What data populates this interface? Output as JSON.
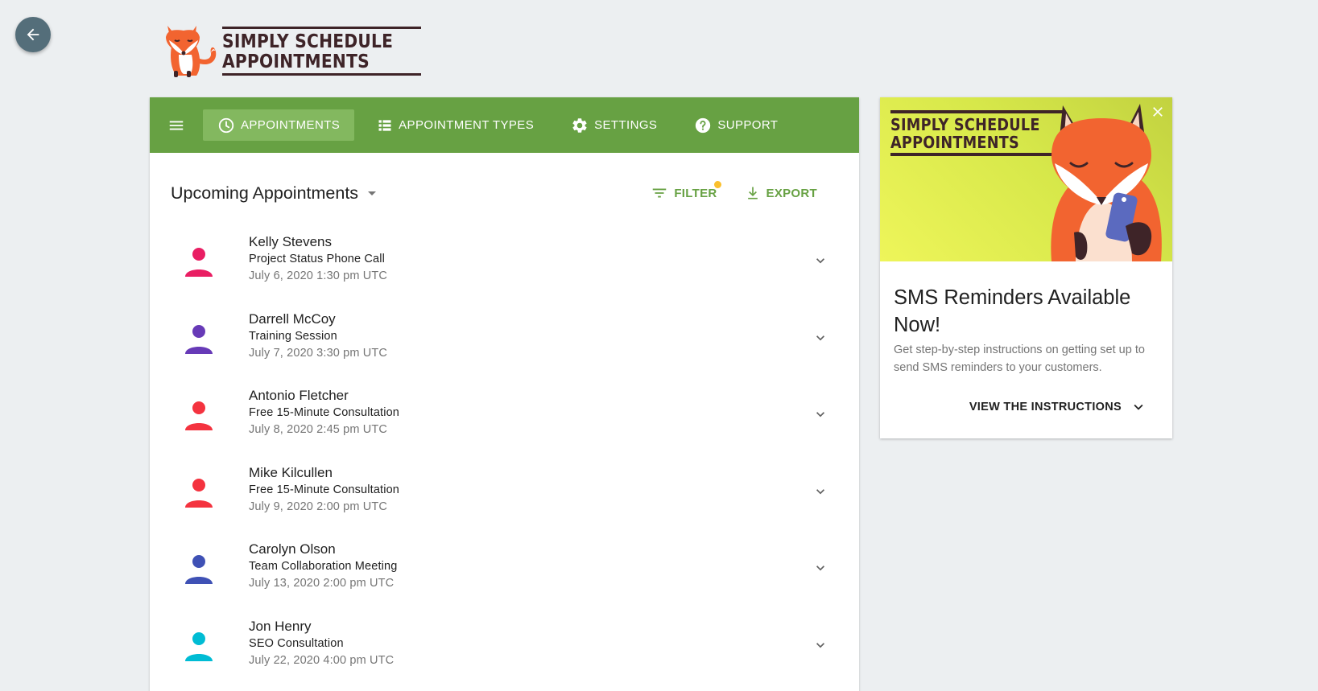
{
  "logo": {
    "line1": "SIMPLY SCHEDULE",
    "line2": "APPOINTMENTS"
  },
  "nav": {
    "items": [
      {
        "label": "APPOINTMENTS",
        "icon": "clock-icon",
        "active": true
      },
      {
        "label": "APPOINTMENT TYPES",
        "icon": "list-icon",
        "active": false
      },
      {
        "label": "SETTINGS",
        "icon": "gear-icon",
        "active": false
      },
      {
        "label": "SUPPORT",
        "icon": "help-icon",
        "active": false
      }
    ]
  },
  "list": {
    "title": "Upcoming Appointments",
    "filter_label": "FILTER",
    "export_label": "EXPORT",
    "appointments": [
      {
        "name": "Kelly Stevens",
        "type": "Project Status Phone Call",
        "date": "July 6, 2020 1:30 pm UTC",
        "color": "#e91e63"
      },
      {
        "name": "Darrell McCoy",
        "type": "Training Session",
        "date": "July 7, 2020 3:30 pm UTC",
        "color": "#673ab7"
      },
      {
        "name": "Antonio Fletcher",
        "type": "Free 15-Minute Consultation",
        "date": "July 8, 2020 2:45 pm UTC",
        "color": "#f4333f"
      },
      {
        "name": "Mike Kilcullen",
        "type": "Free 15-Minute Consultation",
        "date": "July 9, 2020 2:00 pm UTC",
        "color": "#f4333f"
      },
      {
        "name": "Carolyn Olson",
        "type": "Team Collaboration Meeting",
        "date": "July 13, 2020 2:00 pm UTC",
        "color": "#3f51b5"
      },
      {
        "name": "Jon Henry",
        "type": "SEO Consultation",
        "date": "July 22, 2020 4:00 pm UTC",
        "color": "#00bcd4"
      }
    ]
  },
  "promo": {
    "logo_line1": "SIMPLY SCHEDULE",
    "logo_line2": "APPOINTMENTS",
    "title": "SMS Reminders Available Now!",
    "text": "Get step-by-step instructions on getting set up to send SMS reminders to your customers.",
    "link_label": "VIEW THE INSTRUCTIONS"
  },
  "colors": {
    "nav_green": "#67a143",
    "accent_green": "#67a143",
    "filter_dot": "#fbc02d",
    "back_button": "#546e7a"
  }
}
